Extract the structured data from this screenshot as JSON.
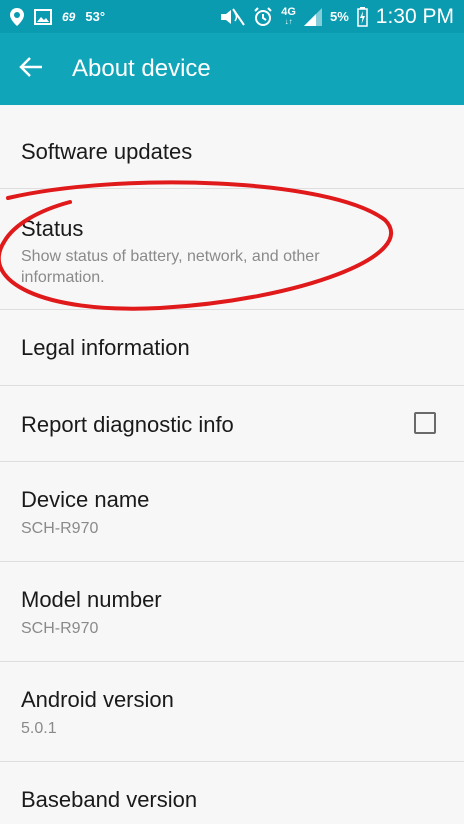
{
  "status_bar": {
    "time": "1:30 PM",
    "notification_text": "69",
    "temperature": "53°",
    "network_type": "4G",
    "network_sub": "↓↑",
    "battery_percent": "5%"
  },
  "app_bar": {
    "title": "About device"
  },
  "items": [
    {
      "title": "Software updates"
    },
    {
      "title": "Status",
      "subtitle": "Show status of battery, network, and other information."
    },
    {
      "title": "Legal information"
    },
    {
      "title": "Report diagnostic info",
      "checked": false
    },
    {
      "title": "Device name",
      "subtitle": "SCH-R970"
    },
    {
      "title": "Model number",
      "subtitle": "SCH-R970"
    },
    {
      "title": "Android version",
      "subtitle": "5.0.1"
    },
    {
      "title": "Baseband version"
    }
  ],
  "colors": {
    "status_bar": "#0a9bb0",
    "app_bar": "#10a5b9",
    "annotation": "#e0191b"
  }
}
